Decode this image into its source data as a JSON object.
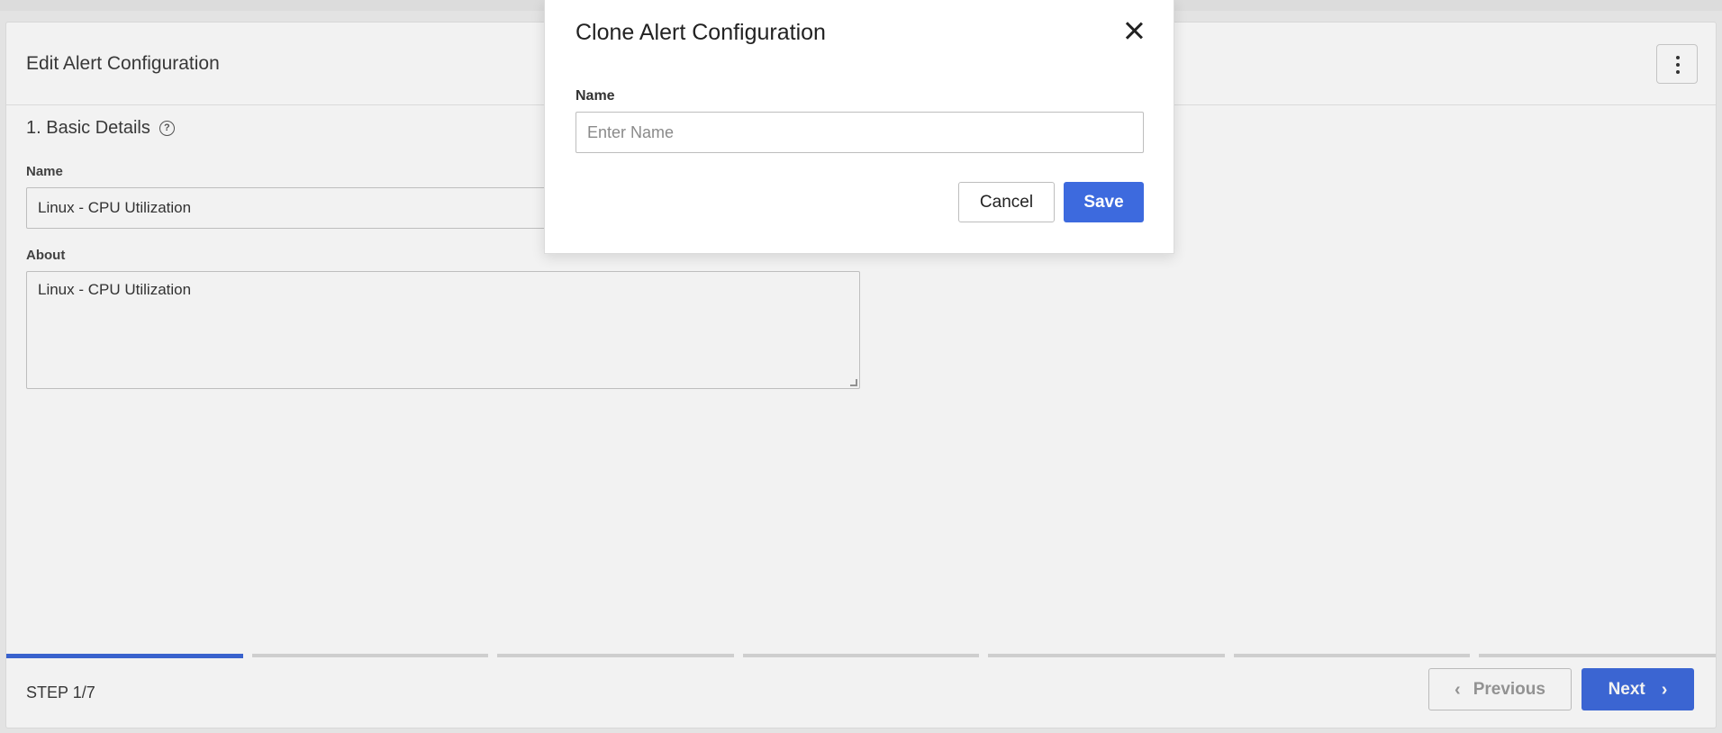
{
  "page": {
    "title": "Edit Alert Configuration",
    "menu_icon": "kebab-vertical-icon"
  },
  "section": {
    "title": "1. Basic Details",
    "help_icon": "help-circle-icon"
  },
  "form": {
    "name_label": "Name",
    "name_value": "Linux - CPU Utilization",
    "about_label": "About",
    "about_value": "Linux - CPU Utilization"
  },
  "wizard": {
    "step_label": "STEP 1/7",
    "total_steps": 7,
    "current_step": 1,
    "previous_label": "Previous",
    "next_label": "Next"
  },
  "modal": {
    "title": "Clone Alert Configuration",
    "name_label": "Name",
    "name_placeholder": "Enter Name",
    "name_value": "",
    "cancel_label": "Cancel",
    "save_label": "Save"
  },
  "colors": {
    "accent": "#3d6ade",
    "progress_active": "#3b66d8",
    "progress_inactive": "#d9d9d9"
  }
}
